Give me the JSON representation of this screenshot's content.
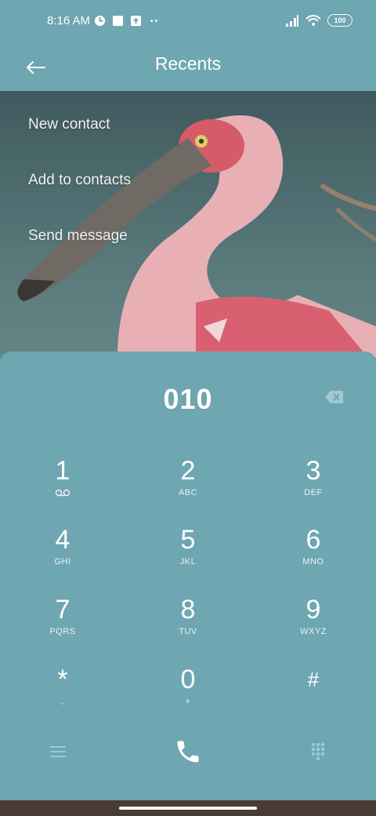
{
  "status_bar": {
    "time": "8:16 AM",
    "battery": "100",
    "left_icons": [
      "notification-icon",
      "square-icon",
      "upload-icon",
      "more-dots-icon"
    ],
    "right_icons": [
      "signal-icon",
      "wifi-icon",
      "battery-icon"
    ]
  },
  "header": {
    "title": "Recents",
    "back_icon": "back-arrow-icon"
  },
  "menu": {
    "items": [
      {
        "label": "New contact"
      },
      {
        "label": "Add to contacts"
      },
      {
        "label": "Send message"
      }
    ]
  },
  "dialer": {
    "number": "010",
    "backspace_icon": "backspace-icon",
    "keys": [
      {
        "digit": "1",
        "letters": ""
      },
      {
        "digit": "2",
        "letters": "ABC"
      },
      {
        "digit": "3",
        "letters": "DEF"
      },
      {
        "digit": "4",
        "letters": "GHI"
      },
      {
        "digit": "5",
        "letters": "JKL"
      },
      {
        "digit": "6",
        "letters": "MNO"
      },
      {
        "digit": "7",
        "letters": "PQRS"
      },
      {
        "digit": "8",
        "letters": "TUV"
      },
      {
        "digit": "9",
        "letters": "WXYZ"
      },
      {
        "digit": "*",
        "letters": ","
      },
      {
        "digit": "0",
        "letters": "+"
      },
      {
        "digit": "#",
        "letters": ""
      }
    ]
  },
  "bottom_bar": {
    "menu_icon": "menu-icon",
    "call_icon": "phone-icon",
    "dialpad_icon": "dialpad-icon"
  },
  "colors": {
    "panel": "#6ea6b2",
    "text": "#ffffff"
  }
}
